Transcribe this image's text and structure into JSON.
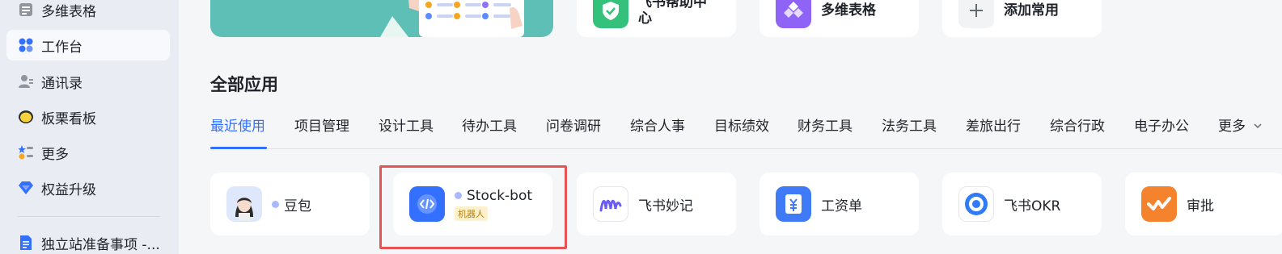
{
  "sidebar": {
    "items": [
      {
        "label": "多维表格",
        "icon": "table-icon"
      },
      {
        "label": "工作台",
        "icon": "workspace-icon"
      },
      {
        "label": "通讯录",
        "icon": "contacts-icon"
      },
      {
        "label": "板栗看板",
        "icon": "board-icon"
      },
      {
        "label": "更多",
        "icon": "more-apps-icon"
      },
      {
        "label": "权益升级",
        "icon": "diamond-icon"
      },
      {
        "label": "独立站准备事项 -...",
        "icon": "doc-icon"
      }
    ]
  },
  "quick_access": [
    {
      "label": "飞书帮助中心"
    },
    {
      "label": "多维表格"
    },
    {
      "label": "添加常用"
    }
  ],
  "section_title": "全部应用",
  "tabs": [
    "最近使用",
    "项目管理",
    "设计工具",
    "待办工具",
    "问卷调研",
    "综合人事",
    "目标绩效",
    "财务工具",
    "法务工具",
    "差旅出行",
    "综合行政",
    "电子办公",
    "更多"
  ],
  "apps": [
    {
      "label": "豆包"
    },
    {
      "label": "Stock-bot",
      "tag": "机器人"
    },
    {
      "label": "飞书妙记"
    },
    {
      "label": "工资单"
    },
    {
      "label": "飞书OKR"
    },
    {
      "label": "审批"
    }
  ],
  "colors": {
    "accent": "#3370ff",
    "highlight": "#e45455",
    "banner": "#5dbfb6"
  }
}
